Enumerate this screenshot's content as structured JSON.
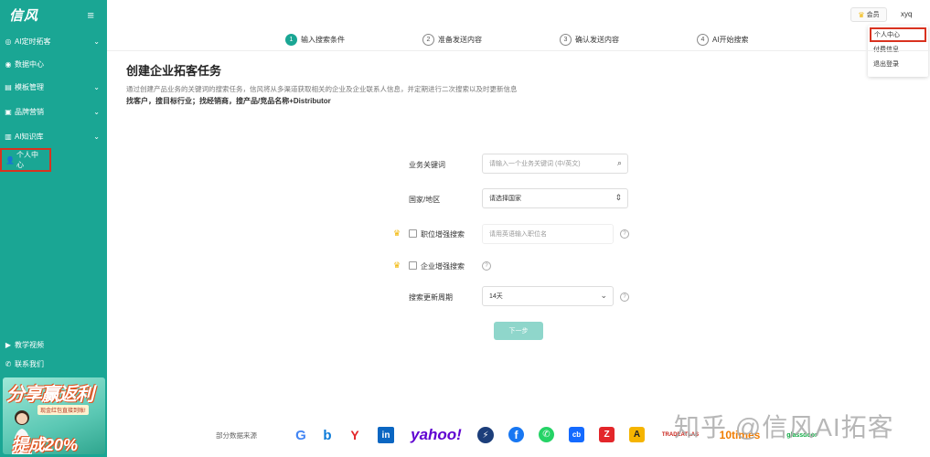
{
  "sidebar": {
    "logo": "信风",
    "menu_icon": "≡",
    "items": [
      {
        "label": "AI定时拓客",
        "icon": "target-icon",
        "has_chevron": true
      },
      {
        "label": "数据中心",
        "icon": "data-icon",
        "has_chevron": false
      },
      {
        "label": "模板管理",
        "icon": "template-icon",
        "has_chevron": true
      },
      {
        "label": "品牌营销",
        "icon": "brand-icon",
        "has_chevron": true
      },
      {
        "label": "AI知识库",
        "icon": "book-icon",
        "has_chevron": true
      },
      {
        "label": "个人中心",
        "icon": "user-icon",
        "has_chevron": false
      }
    ],
    "bottom_items": [
      {
        "label": "教学视频",
        "icon": "video-icon"
      },
      {
        "label": "联系我们",
        "icon": "phone-icon"
      }
    ],
    "promo": {
      "title": "分享赢返利",
      "subtitle": "现金红包直接到账!",
      "bottom": "提成20%"
    }
  },
  "topbar": {
    "vip_label": "会员",
    "username": "xyq"
  },
  "user_menu": [
    "个人中心",
    "付费信息",
    "退出登录"
  ],
  "steps": [
    {
      "num": "1",
      "label": "输入搜索条件",
      "active": true
    },
    {
      "num": "2",
      "label": "准备发送内容",
      "active": false
    },
    {
      "num": "3",
      "label": "确认发送内容",
      "active": false
    },
    {
      "num": "4",
      "label": "AI开始搜索",
      "active": false
    }
  ],
  "page": {
    "title": "创建企业拓客任务",
    "description": "通过创建产品业务的关键词的搜索任务，信风将从多渠道获取相关的企业及企业联系人信息，并定期进行二次搜索以及时更新信息",
    "hint": "找客户，搜目标行业；找经销商，搜产品/竞品名称+Distributor"
  },
  "form": {
    "keyword_label": "业务关键词",
    "keyword_placeholder": "请输入一个业务关键词 (中/英文)",
    "country_label": "国家/地区",
    "country_value": "请选择国家",
    "position_label": "职位增强搜索",
    "position_placeholder": "请用英语输入职位名",
    "company_label": "企业增强搜索",
    "period_label": "搜索更新周期",
    "period_value": "14天",
    "next_button": "下一步"
  },
  "footer": {
    "label": "部分数据来源",
    "sources": [
      {
        "name": "G",
        "icon": "google-icon",
        "color": "#4285f4"
      },
      {
        "name": "b",
        "icon": "bing-icon",
        "color": "#0a7ad8"
      },
      {
        "name": "Y",
        "icon": "yandex-icon",
        "color": "#e3262a"
      },
      {
        "name": "in",
        "icon": "linkedin-icon",
        "color": "#0a66c2"
      },
      {
        "name": "yahoo!",
        "icon": "yahoo-logo",
        "color": "#5f01d1"
      },
      {
        "name": "⚡",
        "icon": "lightning-icon",
        "color": "#1c3e7a"
      },
      {
        "name": "f",
        "icon": "facebook-icon",
        "color": "#1877f2"
      },
      {
        "name": "✆",
        "icon": "whatsapp-icon",
        "color": "#25d366"
      },
      {
        "name": "cb",
        "icon": "crunchbase-icon",
        "color": "#146aff"
      },
      {
        "name": "Z",
        "icon": "zoominfo-icon",
        "color": "#e3262a"
      },
      {
        "name": "A",
        "icon": "alibaba-icon",
        "color": "#f5b400"
      },
      {
        "name": "TRADEATLAS",
        "icon": "tradeatlas-logo",
        "color": "#c8221a"
      },
      {
        "name": "10times",
        "icon": "10times-logo",
        "color": "#f07c00"
      },
      {
        "name": "glassdoor",
        "icon": "glassdoor-logo",
        "color": "#0caa41"
      }
    ]
  },
  "watermark": "知乎 @信风AI拓客"
}
